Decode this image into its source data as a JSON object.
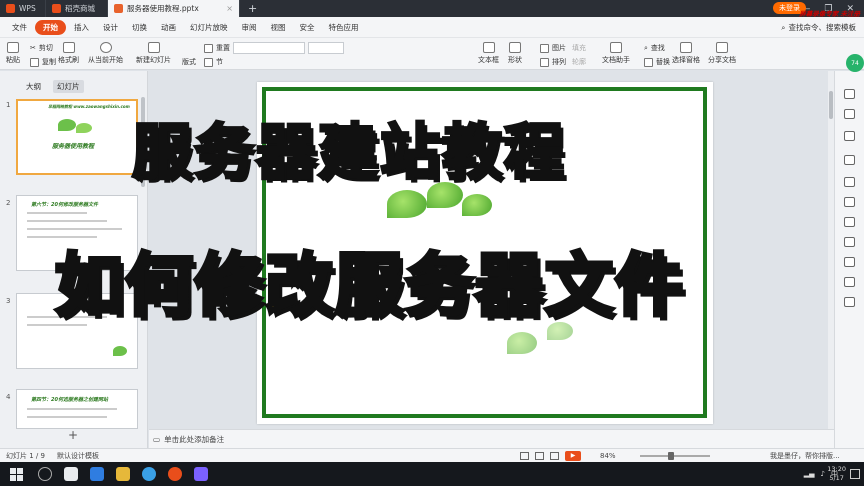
{
  "tabs": {
    "app": "WPS",
    "store": "稻壳商城",
    "doc": "服务器使用教程.pptx"
  },
  "menu": {
    "file": "文件",
    "items": [
      "开始",
      "插入",
      "设计",
      "切换",
      "动画",
      "幻灯片放映",
      "审阅",
      "视图",
      "安全",
      "特色应用"
    ],
    "search": "查找命令、搜索模板",
    "login": "未登录",
    "brand": "屏幕录像专家 未注册"
  },
  "ribbon": {
    "paste": "粘贴",
    "cut": "剪切",
    "copy": "复制",
    "format_painter": "格式刷",
    "from_current": "从当前开始",
    "new_slide": "新建幻灯片",
    "layout": "版式",
    "section": "节",
    "reset": "重置",
    "textbox": "文本框",
    "shape": "形状",
    "arrange": "排列",
    "picture": "图片",
    "fill": "填充",
    "outline": "轮廓",
    "doc_assistant": "文档助手",
    "find": "查找",
    "replace": "替换",
    "select_pane": "选择窗格",
    "share": "分享文档"
  },
  "left_panel": {
    "tab_outline": "大纲",
    "tab_slides": "幻灯片",
    "slide_numbers": [
      "1",
      "2",
      "3",
      "4"
    ],
    "thumb1_url": "早稻网络教程 www.zaowangshixin.com",
    "thumb1_title": "服务器使用教程",
    "thumb2_title": "第六节：20何修改服务器文件",
    "thumb4_title": "第四节：20何选服务器之创建网站",
    "add": "+"
  },
  "overlay": {
    "line1": "服务器建站教程",
    "line2": "如何修改服务器文件"
  },
  "notes": {
    "placeholder": "单击此处添加备注"
  },
  "status": {
    "slide_info": "幻灯片 1 / 9",
    "template": "默认设计模板",
    "zoom": "84%",
    "assistant": "我是墨仔，帮你排版..."
  },
  "taskbar": {
    "time": "13:20",
    "date": "5/17",
    "lang": "中"
  },
  "badge": "74"
}
